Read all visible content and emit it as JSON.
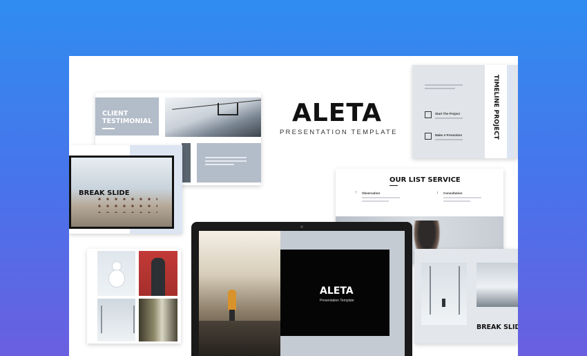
{
  "hero": {
    "title": "ALETA",
    "subtitle": "PRESENTATION TEMPLATE"
  },
  "testimonial": {
    "label": "CLIENT TESTIMONIAL"
  },
  "break_left": {
    "label": "BREAK SLIDE"
  },
  "break_right": {
    "label": "BREAK SLIDE"
  },
  "timeline": {
    "label": "TIMELINE PROJECT",
    "item1": "Start The Project",
    "item2": "Make A Promotion"
  },
  "list_service": {
    "label": "OUR LIST SERVICE",
    "col1": "Observation",
    "col2": "Consultation"
  },
  "laptop_slide": {
    "title": "ALETA",
    "subtitle": "Presentation Template"
  },
  "colors": {
    "gray_slate": "#b3bcc9",
    "pale_blue": "#dde5f3",
    "dark": "#111111"
  }
}
